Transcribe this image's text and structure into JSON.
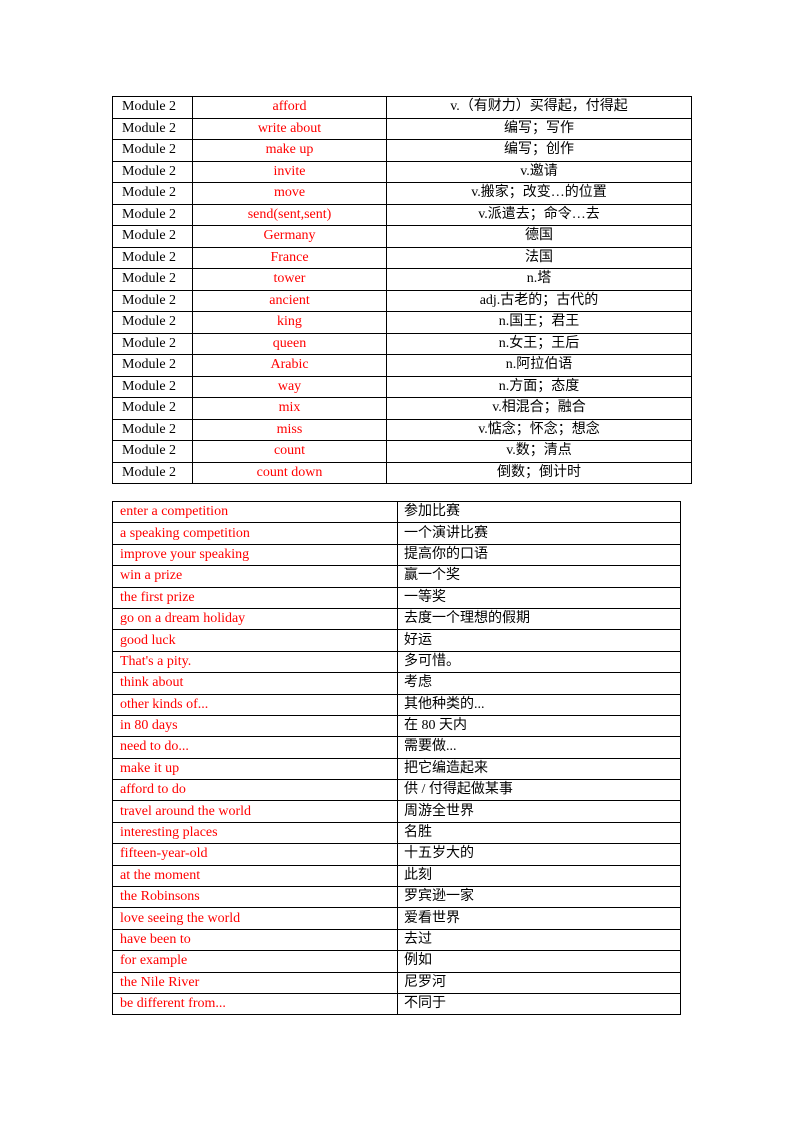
{
  "vocabulary": {
    "rows": [
      {
        "module": "Module 2",
        "word": "afford",
        "meaning": "v.（有财力）买得起，付得起"
      },
      {
        "module": "Module 2",
        "word": "write about",
        "meaning": "编写；写作"
      },
      {
        "module": "Module 2",
        "word": "make up",
        "meaning": "编写；创作"
      },
      {
        "module": "Module 2",
        "word": "invite",
        "meaning": "v.邀请"
      },
      {
        "module": "Module 2",
        "word": "move",
        "meaning": "v.搬家；改变…的位置"
      },
      {
        "module": "Module 2",
        "word": "send(sent,sent)",
        "meaning": "v.派遣去；命令…去"
      },
      {
        "module": "Module 2",
        "word": "Germany",
        "meaning": "德国"
      },
      {
        "module": "Module 2",
        "word": "France",
        "meaning": "法国"
      },
      {
        "module": "Module 2",
        "word": "tower",
        "meaning": "n.塔"
      },
      {
        "module": "Module 2",
        "word": "ancient",
        "meaning": "adj.古老的；古代的"
      },
      {
        "module": "Module 2",
        "word": "king",
        "meaning": "n.国王；君王"
      },
      {
        "module": "Module 2",
        "word": "queen",
        "meaning": "n.女王；王后"
      },
      {
        "module": "Module 2",
        "word": "Arabic",
        "meaning": "n.阿拉伯语"
      },
      {
        "module": "Module 2",
        "word": "way",
        "meaning": "n.方面；态度"
      },
      {
        "module": "Module 2",
        "word": "mix",
        "meaning": "v.相混合；融合"
      },
      {
        "module": "Module 2",
        "word": "miss",
        "meaning": "v.惦念；怀念；想念"
      },
      {
        "module": "Module 2",
        "word": "count",
        "meaning": "v.数；清点"
      },
      {
        "module": "Module 2",
        "word": "count down",
        "meaning": "倒数；倒计时"
      }
    ]
  },
  "phrases": {
    "rows": [
      {
        "phrase": "enter a competition",
        "meaning": "参加比赛"
      },
      {
        "phrase": "a speaking competition",
        "meaning": "一个演讲比赛"
      },
      {
        "phrase": "improve your speaking",
        "meaning": "提高你的口语"
      },
      {
        "phrase": "win a prize",
        "meaning": "赢一个奖"
      },
      {
        "phrase": "the first prize",
        "meaning": "一等奖"
      },
      {
        "phrase": "go on a dream holiday",
        "meaning": "去度一个理想的假期"
      },
      {
        "phrase": "good luck",
        "meaning": "好运"
      },
      {
        "phrase": "That's a pity.",
        "meaning": "多可惜。"
      },
      {
        "phrase": "think about",
        "meaning": "考虑"
      },
      {
        "phrase": "other kinds of...",
        "meaning": "其他种类的..."
      },
      {
        "phrase": "in 80 days",
        "meaning": "在 80 天内"
      },
      {
        "phrase": "need to do...",
        "meaning": "需要做..."
      },
      {
        "phrase": "make it up",
        "meaning": "把它编造起来"
      },
      {
        "phrase": "afford to do",
        "meaning": "供 / 付得起做某事"
      },
      {
        "phrase": "travel around the world",
        "meaning": "周游全世界"
      },
      {
        "phrase": "interesting places",
        "meaning": "名胜"
      },
      {
        "phrase": "fifteen-year-old",
        "meaning": "十五岁大的"
      },
      {
        "phrase": "at the moment",
        "meaning": "此刻"
      },
      {
        "phrase": "the Robinsons",
        "meaning": "罗宾逊一家"
      },
      {
        "phrase": "love seeing the world",
        "meaning": "爱看世界"
      },
      {
        "phrase": "have been to",
        "meaning": "去过"
      },
      {
        "phrase": "for example",
        "meaning": "例如"
      },
      {
        "phrase": "the Nile River",
        "meaning": "尼罗河"
      },
      {
        "phrase": "be different from...",
        "meaning": "不同于"
      }
    ]
  },
  "colors": {
    "highlight": "#ff0000",
    "text": "#000000"
  }
}
